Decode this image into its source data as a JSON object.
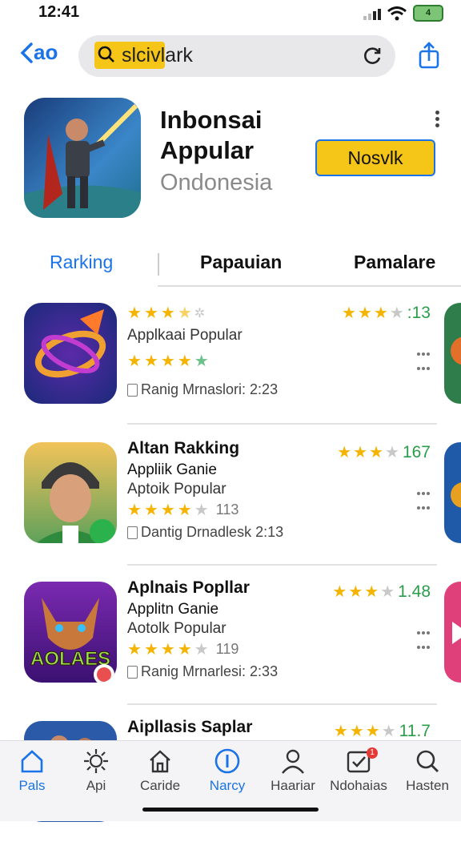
{
  "status_bar": {
    "time": "12:41",
    "battery_text": "4"
  },
  "nav": {
    "back_label": "ao",
    "search_text": "slcivlark",
    "back_icon": "chevron-left-icon",
    "search_icon": "search-icon",
    "reload_icon": "reload-icon",
    "share_icon": "share-icon"
  },
  "hero": {
    "title_line1": "Inbonsai",
    "title_line2": "Appular",
    "subtitle": "Ondonesia",
    "button_label": "Nosvlk",
    "accent": "#f5c518"
  },
  "tabs": [
    {
      "label": "Rarking",
      "active": true
    },
    {
      "label": "Papauian",
      "active": false
    },
    {
      "label": "Pamalare",
      "active": false
    }
  ],
  "apps": [
    {
      "name": "",
      "line2": "",
      "line3": "Applkaai  Popular",
      "top_stars": 3.5,
      "stars": 4,
      "star_count": "",
      "rating_stars": 3,
      "rating_value": ":13",
      "meta": "Ranig Mrnaslori: 2:23"
    },
    {
      "name": "Altan Rakking",
      "line2": "Appliik Ganie",
      "line3": "Aptoik Popular",
      "stars": 4,
      "star_count": "113",
      "rating_stars": 3,
      "rating_value": "167",
      "meta": "Dantig Drnadlesk 2:13"
    },
    {
      "name": "Aplnais Popllar",
      "line2": "Applitn Ganie",
      "line3": "Aotolk Popular",
      "stars": 4,
      "star_count": "119",
      "rating_stars": 3,
      "rating_value": "1.48",
      "meta": "Ranig Mrnarlesi: 2:33"
    },
    {
      "name": "Aipllasis Saplar",
      "rating_stars": 3,
      "rating_value": "11.7"
    }
  ],
  "icon_text": {
    "game_logo": "AOLAES"
  },
  "tab_bar": [
    {
      "label": "Pals",
      "icon": "home-icon",
      "active": true
    },
    {
      "label": "Api",
      "icon": "sun-icon",
      "active": false
    },
    {
      "label": "Caride",
      "icon": "house-icon",
      "active": false
    },
    {
      "label": "Narcy",
      "icon": "info-icon",
      "active": true
    },
    {
      "label": "Haariar",
      "icon": "person-icon",
      "active": false
    },
    {
      "label": "Ndohaias",
      "icon": "checkbox-icon",
      "active": false,
      "badge": "1"
    },
    {
      "label": "Hasten",
      "icon": "search-icon",
      "active": false
    }
  ]
}
